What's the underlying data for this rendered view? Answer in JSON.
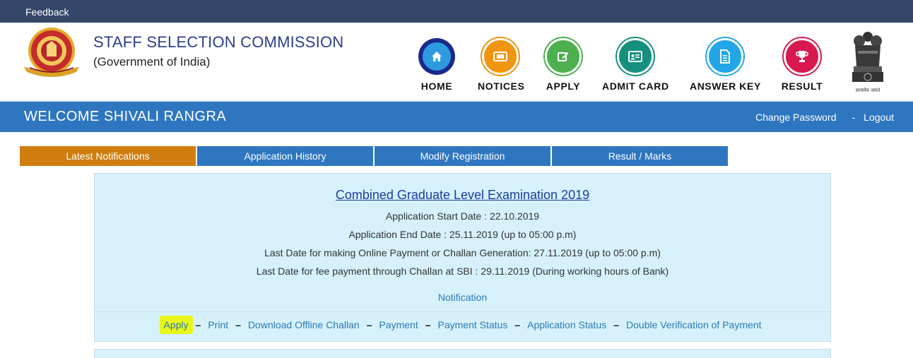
{
  "topbar": {
    "feedback": "Feedback"
  },
  "header": {
    "org_name": "STAFF SELECTION COMMISSION",
    "org_sub": "(Government of India)",
    "emblem_text": "सत्यमेव जयते"
  },
  "nav": [
    {
      "label": "HOME",
      "icon": "home-icon",
      "ring": "#1a2a8a",
      "fill": "#2e9be0"
    },
    {
      "label": "NOTICES",
      "icon": "notices-icon",
      "ring": "#f1940f",
      "fill": "#f1940f"
    },
    {
      "label": "APPLY",
      "icon": "apply-icon",
      "ring": "#4daf4e",
      "fill": "#4daf4e"
    },
    {
      "label": "ADMIT CARD",
      "icon": "admit-card-icon",
      "ring": "#15907f",
      "fill": "#15907f"
    },
    {
      "label": "ANSWER KEY",
      "icon": "answer-key-icon",
      "ring": "#22a6e8",
      "fill": "#22a6e8"
    },
    {
      "label": "RESULT",
      "icon": "result-icon",
      "ring": "#d8194f",
      "fill": "#d8194f"
    }
  ],
  "welcome": {
    "text": "WELCOME SHIVALI RANGRA",
    "change_password": "Change Password",
    "separator": "-",
    "logout": "Logout"
  },
  "tabs": [
    {
      "label": "Latest Notifications",
      "active": true
    },
    {
      "label": "Application History",
      "active": false
    },
    {
      "label": "Modify Registration",
      "active": false
    },
    {
      "label": "Result / Marks",
      "active": false
    }
  ],
  "notification": {
    "title": "Combined Graduate Level Examination 2019",
    "lines": [
      "Application Start Date : 22.10.2019",
      "Application End Date : 25.11.2019 (up to 05:00 p.m)",
      "Last Date for making Online Payment or Challan Generation: 27.11.2019 (up to 05:00 p.m)",
      "Last Date for fee payment through Challan at SBI : 29.11.2019 (During working hours of Bank)"
    ],
    "notification_link": "Notification",
    "actions": {
      "apply": "Apply",
      "print": "Print",
      "download_challan": "Download Offline Challan",
      "payment": "Payment",
      "payment_status": "Payment Status",
      "application_status": "Application Status",
      "double_verification": "Double Verification of Payment"
    },
    "dash": "–"
  },
  "colors": {
    "topbar": "#34466a",
    "brand_blue": "#2e76c0",
    "active_tab": "#cf7d0f",
    "panel_bg": "#d6f1fb",
    "link": "#2a7ab5",
    "highlight": "#e9f719"
  }
}
